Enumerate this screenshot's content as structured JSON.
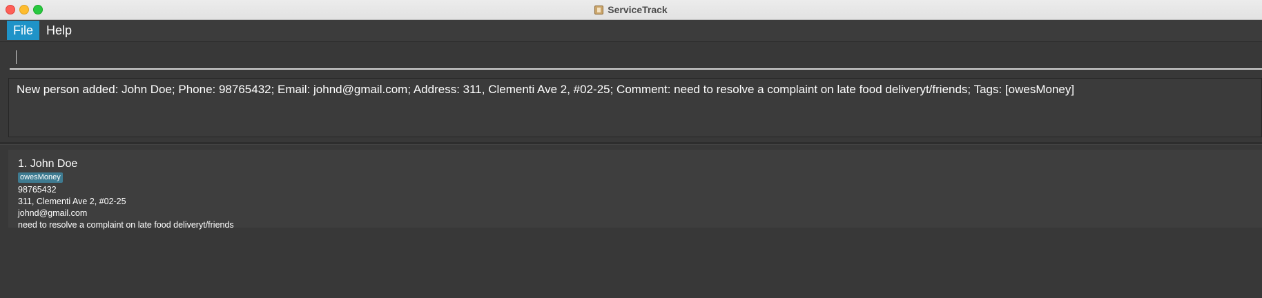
{
  "window": {
    "title": "ServiceTrack",
    "icon": "app-icon"
  },
  "menu": {
    "items": [
      {
        "label": "File",
        "selected": true
      },
      {
        "label": "Help",
        "selected": false
      }
    ]
  },
  "command": {
    "value": "",
    "placeholder": ""
  },
  "result": {
    "message": "New person added: John Doe; Phone: 98765432; Email: johnd@gmail.com; Address: 311, Clementi Ave 2, #02-25; Comment: need to resolve a complaint on late food deliveryt/friends; Tags: [owesMoney]"
  },
  "persons": [
    {
      "index_name": "1. John Doe",
      "tags": [
        "owesMoney"
      ],
      "phone": "98765432",
      "address": "311, Clementi Ave 2, #02-25",
      "email": "johnd@gmail.com",
      "comment": "need to resolve a complaint on late food deliveryt/friends"
    }
  ],
  "colors": {
    "background": "#383838",
    "menu_selected": "#1f93c8",
    "tag": "#3e7b91",
    "close": "#fe5f57",
    "minimize": "#febc2e",
    "maximize": "#28c840"
  }
}
